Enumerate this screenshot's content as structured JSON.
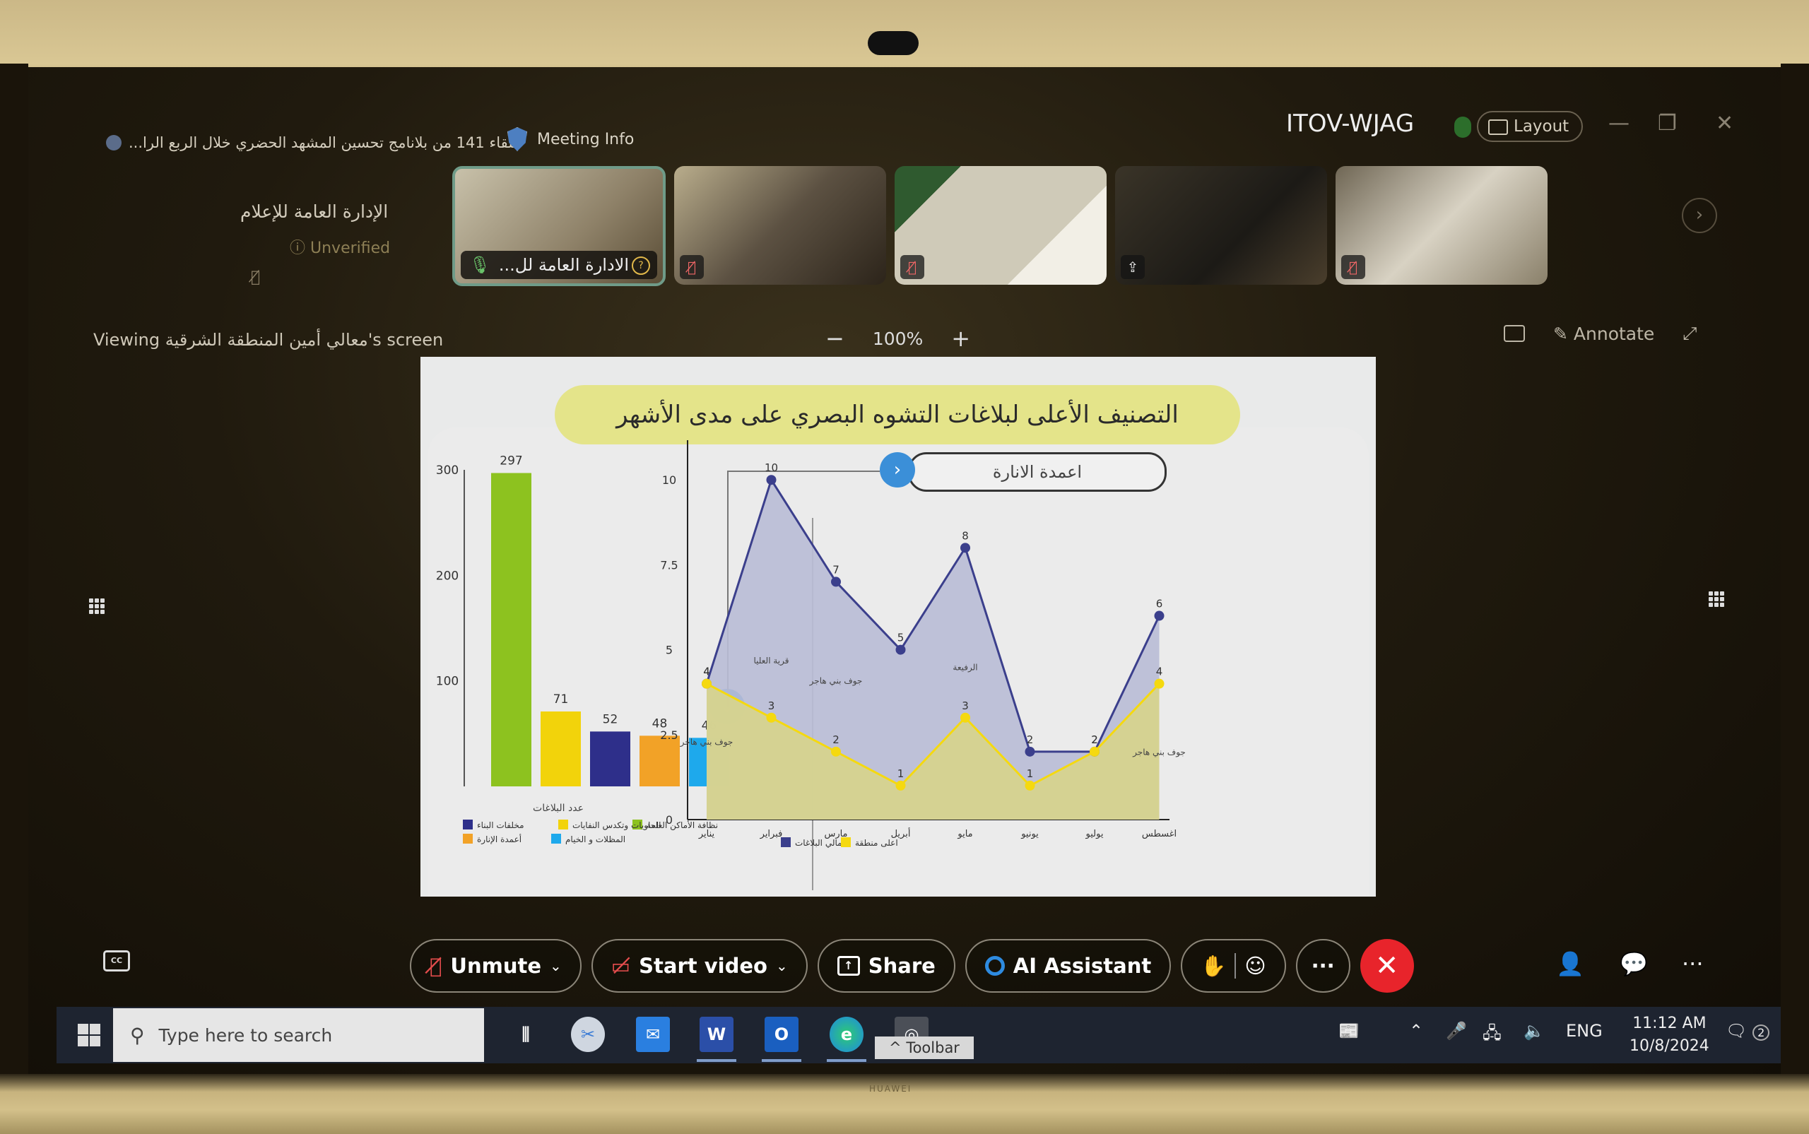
{
  "window": {
    "meeting_title": "اللقاء 141 من بلانامج تحسين المشهد الحضري خلال الربع الرا...",
    "meeting_info_label": "Meeting Info",
    "host_name": "ITOV-WJAG",
    "layout_label": "Layout",
    "minimize": "—",
    "restore": "❐",
    "close": "✕"
  },
  "participants": {
    "self": {
      "name": "الإدارة العامة للإعلام",
      "status": "Unverified"
    },
    "tiles": [
      {
        "label": "الادارة العامة لل...",
        "muted": false,
        "active": true
      },
      {
        "label": "",
        "muted": true
      },
      {
        "label": "",
        "muted": true
      },
      {
        "label": "",
        "muted": false,
        "share_indicator": true
      },
      {
        "label": "",
        "muted": true
      }
    ]
  },
  "share_bar": {
    "viewing_label": "Viewing معالي أمين المنطقة الشرقية's screen",
    "zoom_out": "−",
    "zoom_level": "100%",
    "zoom_in": "+",
    "annotate_label": "Annotate"
  },
  "slide": {
    "title": "التصنيف الأعلى لبلاغات التشوه البصري على مدى الأشهر",
    "selected_category_pill": "اعمدة الانارة"
  },
  "chart_data": [
    {
      "type": "bar",
      "title": "",
      "xlabel": "عدد البلاغات",
      "ylabel": "",
      "ylim": [
        0,
        300
      ],
      "yticks": [
        100,
        200,
        300
      ],
      "categories": [
        "نظافة الأماكن العامة",
        "الحاويات وتكدس النفايات",
        "مخلفات البناء",
        "أعمدة الإنارة",
        "المظلات و الخيام"
      ],
      "values": [
        297,
        71,
        52,
        48,
        46
      ],
      "colors": [
        "#8dc21f",
        "#f2d30b",
        "#2e2f8a",
        "#f2a227",
        "#1ea9ec"
      ],
      "legend": [
        {
          "label": "نظافة الأماكن العامة",
          "color": "#8dc21f"
        },
        {
          "label": "الحاويات وتكدس النفايات",
          "color": "#f2d30b"
        },
        {
          "label": "مخلفات البناء",
          "color": "#2e2f8a"
        },
        {
          "label": "أعمدة الإنارة",
          "color": "#f2a227"
        },
        {
          "label": "المظلات و الخيام",
          "color": "#1ea9ec"
        }
      ],
      "legend_position": "bottom",
      "grid": false
    },
    {
      "type": "area",
      "title": "",
      "xlabel": "",
      "ylabel": "",
      "ylim": [
        0,
        10
      ],
      "yticks": [
        0,
        2.5,
        5,
        7.5,
        10
      ],
      "ytick_labels": [
        "0",
        "2.5",
        "5",
        "7.5",
        "10"
      ],
      "categories": [
        "يناير",
        "فبراير",
        "مارس",
        "أبريل",
        "مايو",
        "يونيو",
        "يوليو",
        "اغسطس"
      ],
      "series": [
        {
          "name": "اجمالي البلاغات",
          "color": "#3b3f8c",
          "fill": "#b9bdd6",
          "values": [
            4,
            10,
            7,
            5,
            8,
            2,
            2,
            6
          ]
        },
        {
          "name": "اعلى منطقة",
          "color": "#f5d90f",
          "fill": "#d6d38e",
          "values": [
            4,
            3,
            2,
            1,
            3,
            1,
            2,
            4
          ]
        }
      ],
      "annotations": [
        {
          "text": "قرية العليا",
          "x_index": 1,
          "y": 4.6
        },
        {
          "text": "جوف بني هاجر",
          "x_index": 2,
          "y": 4.0
        },
        {
          "text": "الرفيعة",
          "x_index": 4,
          "y": 4.4
        },
        {
          "text": "جوف بني هاجر",
          "x_index": 0,
          "y": 2.2
        },
        {
          "text": "جوف بني هاجر",
          "x_index": 7,
          "y": 1.9
        }
      ],
      "legend": [
        {
          "label": "اجمالي البلاغات",
          "color": "#3b3f8c"
        },
        {
          "label": "اعلى منطقة",
          "color": "#f5d90f"
        }
      ],
      "legend_position": "bottom",
      "grid": false
    }
  ],
  "meeting_toolbar": {
    "unmute": "Unmute",
    "start_video": "Start video",
    "share": "Share",
    "ai_assistant": "AI Assistant",
    "more": "···",
    "leave": "✕"
  },
  "taskbar": {
    "search_placeholder": "Type here to search",
    "tooltip": "^ Toolbar",
    "language": "ENG",
    "time": "11:12 AM",
    "date": "10/8/2024",
    "notifications_count": "2"
  },
  "bezel": {
    "brand": "HUAWEI"
  }
}
